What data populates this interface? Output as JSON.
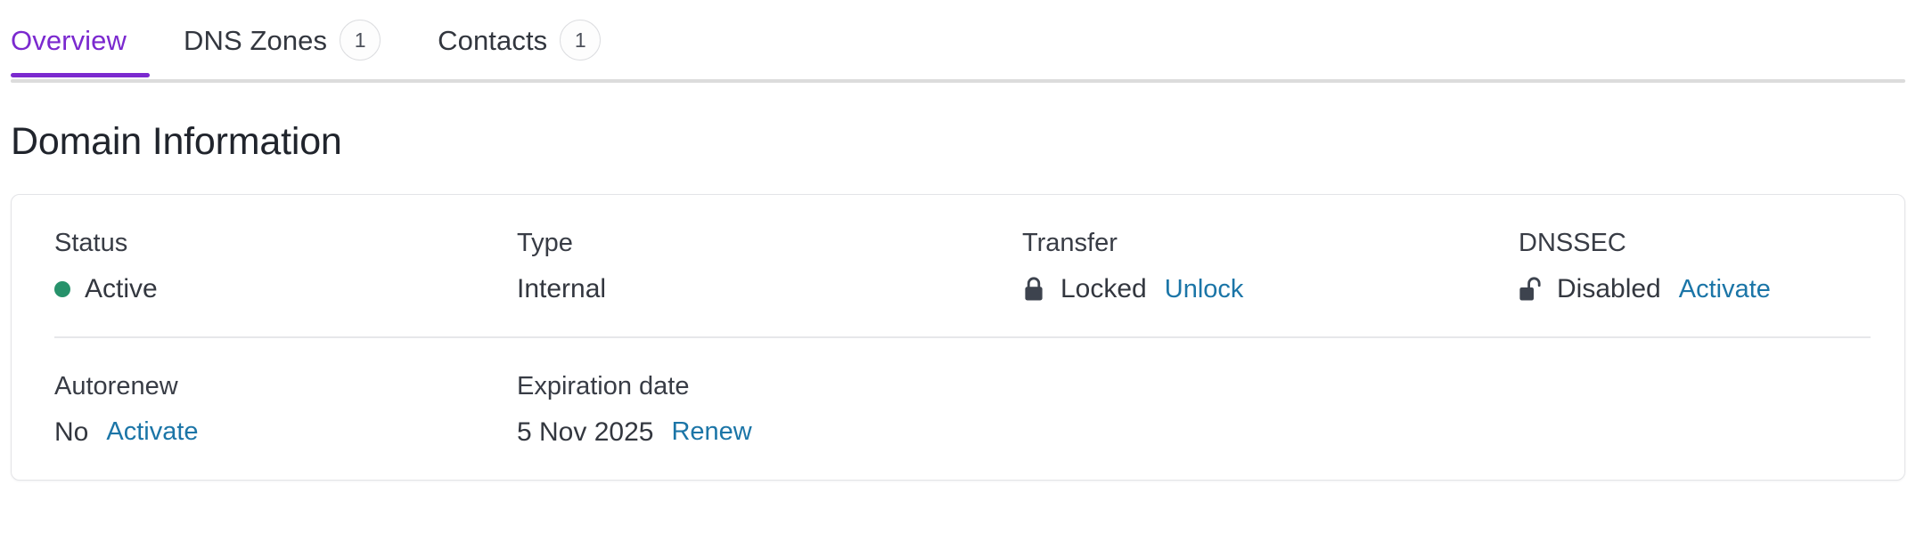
{
  "tabs": [
    {
      "label": "Overview",
      "badge": null,
      "active": true
    },
    {
      "label": "DNS Zones",
      "badge": "1",
      "active": false
    },
    {
      "label": "Contacts",
      "badge": "1",
      "active": false
    }
  ],
  "section": {
    "title": "Domain Information"
  },
  "fields": {
    "status": {
      "label": "Status",
      "value": "Active",
      "icon": "status-dot-green",
      "action": null
    },
    "type": {
      "label": "Type",
      "value": "Internal",
      "icon": null,
      "action": null
    },
    "transfer": {
      "label": "Transfer",
      "value": "Locked",
      "icon": "lock-closed-icon",
      "action": "Unlock"
    },
    "dnssec": {
      "label": "DNSSEC",
      "value": "Disabled",
      "icon": "lock-open-icon",
      "action": "Activate"
    },
    "autorenew": {
      "label": "Autorenew",
      "value": "No",
      "icon": null,
      "action": "Activate"
    },
    "expiration": {
      "label": "Expiration date",
      "value": "5 Nov 2025",
      "icon": null,
      "action": "Renew"
    }
  },
  "colors": {
    "accent_purple": "#7b29cf",
    "link_blue": "#1b75a7",
    "status_green": "#27926b",
    "text_primary": "#20242c",
    "text_body": "#33373f",
    "border": "#e3e4e7",
    "tabbar_rule": "#dcdcdc"
  }
}
